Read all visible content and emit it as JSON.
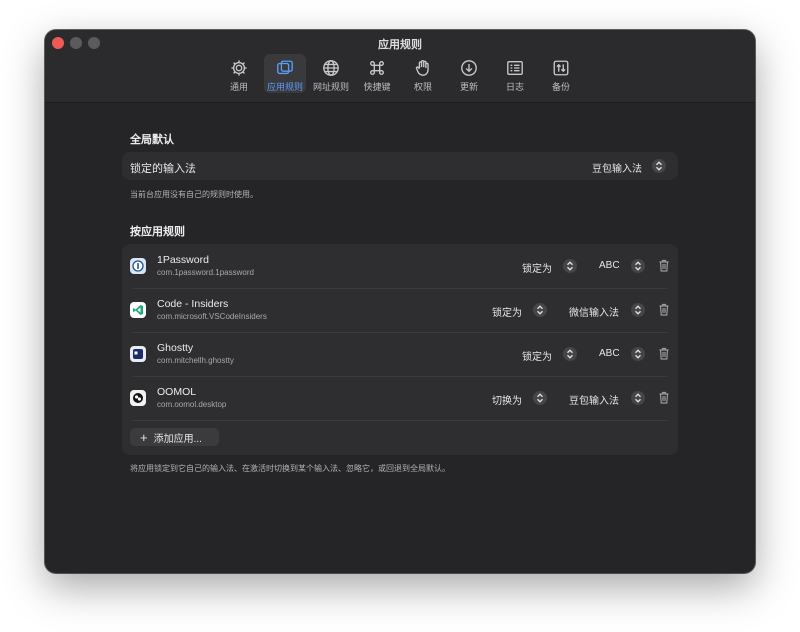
{
  "window": {
    "title": "应用规则"
  },
  "toolbar": {
    "items": [
      {
        "label": "通用",
        "icon": "gear-icon",
        "active": false
      },
      {
        "label": "应用规则",
        "icon": "windows-icon",
        "active": true
      },
      {
        "label": "网址规则",
        "icon": "globe-icon",
        "active": false
      },
      {
        "label": "快捷键",
        "icon": "command-icon",
        "active": false
      },
      {
        "label": "权限",
        "icon": "hand-icon",
        "active": false
      },
      {
        "label": "更新",
        "icon": "download-circle-icon",
        "active": false
      },
      {
        "label": "日志",
        "icon": "log-icon",
        "active": false
      },
      {
        "label": "备份",
        "icon": "backup-icon",
        "active": false
      }
    ]
  },
  "global_default": {
    "heading": "全局默认",
    "row_label": "锁定的输入法",
    "value": "豆包输入法",
    "hint": "当前台应用没有自己的规则时使用。"
  },
  "app_rules": {
    "heading": "按应用规则",
    "apps": [
      {
        "name": "1Password",
        "bundle_id": "com.1password.1password",
        "mode": "锁定为",
        "input": "ABC",
        "icon": "onepassword-icon"
      },
      {
        "name": "Code - Insiders",
        "bundle_id": "com.microsoft.VSCodeInsiders",
        "mode": "锁定为",
        "input": "微信输入法",
        "icon": "vscode-insiders-icon"
      },
      {
        "name": "Ghostty",
        "bundle_id": "com.mitchellh.ghostty",
        "mode": "锁定为",
        "input": "ABC",
        "icon": "ghostty-icon"
      },
      {
        "name": "OOMOL",
        "bundle_id": "com.oomol.desktop",
        "mode": "切换为",
        "input": "豆包输入法",
        "icon": "oomol-icon"
      }
    ],
    "add_button": "添加应用...",
    "footer": "将应用锁定到它自己的输入法、在激活时切换到某个输入法、忽略它，或回退到全局默认。"
  },
  "colors": {
    "accent": "#5b9cf5",
    "window_bg": "#252527",
    "card_bg": "#2e2e30",
    "close": "#ee5b56"
  }
}
